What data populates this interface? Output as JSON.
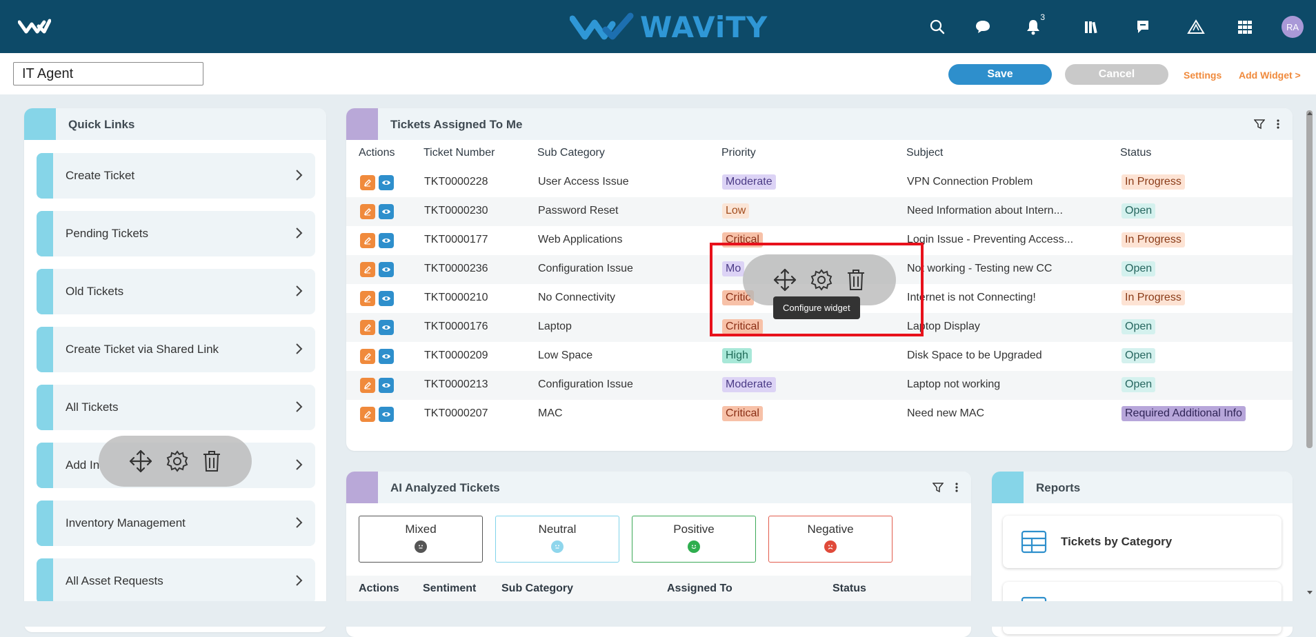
{
  "header": {
    "brand": "WAViTY",
    "notification_count": "3",
    "avatar_initials": "RA",
    "icons": [
      "search-icon",
      "chat-icon",
      "bell-icon",
      "library-icon",
      "feedback-icon",
      "alert-triangle-icon",
      "grid-icon"
    ]
  },
  "toolbar": {
    "dashboard_name": "IT Agent",
    "save_label": "Save",
    "cancel_label": "Cancel",
    "settings_label": "Settings",
    "add_widget_label": "Add Widget >"
  },
  "quick_links": {
    "title": "Quick Links",
    "items": [
      {
        "label": "Create Ticket"
      },
      {
        "label": "Pending Tickets"
      },
      {
        "label": "Old Tickets"
      },
      {
        "label": "Create Ticket via Shared Link"
      },
      {
        "label": "All Tickets"
      },
      {
        "label": "Add In"
      },
      {
        "label": "Inventory Management"
      },
      {
        "label": "All Asset Requests"
      }
    ]
  },
  "tickets": {
    "title": "Tickets Assigned To Me",
    "columns": [
      "Actions",
      "Ticket Number",
      "Sub Category",
      "Priority",
      "Subject",
      "Status"
    ],
    "rows": [
      {
        "number": "TKT0000228",
        "sub": "User Access Issue",
        "priority": "Moderate",
        "subject": "VPN Connection Problem",
        "status": "In Progress"
      },
      {
        "number": "TKT0000230",
        "sub": "Password Reset",
        "priority": "Low",
        "subject": "Need Information about Intern...",
        "status": "Open"
      },
      {
        "number": "TKT0000177",
        "sub": "Web Applications",
        "priority": "Critical",
        "subject": "Login Issue - Preventing Access...",
        "status": "In Progress"
      },
      {
        "number": "TKT0000236",
        "sub": "Configuration Issue",
        "priority": "Mo",
        "subject": "Not working - Testing new CC",
        "status": "Open"
      },
      {
        "number": "TKT0000210",
        "sub": "No Connectivity",
        "priority": "Critic",
        "subject": "Internet is not Connecting!",
        "status": "In Progress"
      },
      {
        "number": "TKT0000176",
        "sub": "Laptop",
        "priority": "Critical",
        "subject": "Laptop Display",
        "status": "Open"
      },
      {
        "number": "TKT0000209",
        "sub": "Low Space",
        "priority": "High",
        "subject": "Disk Space to be Upgraded",
        "status": "Open"
      },
      {
        "number": "TKT0000213",
        "sub": "Configuration Issue",
        "priority": "Moderate",
        "subject": "Laptop not working",
        "status": "Open"
      },
      {
        "number": "TKT0000207",
        "sub": "MAC",
        "priority": "Critical",
        "subject": "Need new MAC",
        "status": "Required Additional Info"
      }
    ],
    "widget_tooltip": "Configure widget"
  },
  "ai": {
    "title": "AI Analyzed Tickets",
    "sentiments": [
      {
        "label": "Mixed",
        "color": "#555555",
        "bg": "#555555"
      },
      {
        "label": "Neutral",
        "color": "#7fd3ea",
        "bg": "#8fd6ec"
      },
      {
        "label": "Positive",
        "color": "#3aa856",
        "bg": "#2fae4f"
      },
      {
        "label": "Negative",
        "color": "#e25b4c",
        "bg": "#e04a3a"
      }
    ],
    "columns": [
      "Actions",
      "Sentiment",
      "Sub Category",
      "Assigned To",
      "Status"
    ]
  },
  "reports": {
    "title": "Reports",
    "items": [
      {
        "label": "Tickets by Category"
      }
    ]
  },
  "colors": {
    "priority": {
      "Moderate": {
        "bg": "#dcd3f5",
        "fg": "#4b3b86"
      },
      "Mo": {
        "bg": "#dcd3f5",
        "fg": "#4b3b86"
      },
      "Low": {
        "bg": "#fbe5d6",
        "fg": "#a24d1e"
      },
      "Critical": {
        "bg": "#f7c1a8",
        "fg": "#8a2e14"
      },
      "Critic": {
        "bg": "#f7c1a8",
        "fg": "#8a2e14"
      },
      "High": {
        "bg": "#a8e8d8",
        "fg": "#1f6b58"
      }
    },
    "status": {
      "In Progress": {
        "bg": "#fde3d4",
        "fg": "#8a3b17"
      },
      "Open": {
        "bg": "#d4f1ee",
        "fg": "#26665f"
      },
      "Required Additional Info": {
        "bg": "#b7a6da",
        "fg": "#2f2456"
      }
    }
  }
}
